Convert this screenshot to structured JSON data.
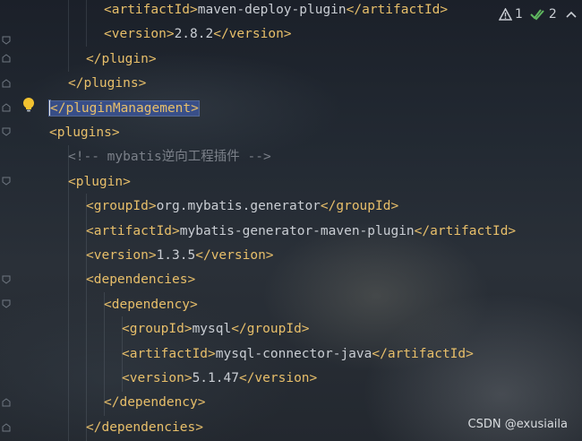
{
  "editor": {
    "lines": [
      {
        "parts": [
          {
            "t": "tag",
            "v": "<artifactId>"
          },
          {
            "t": "txt",
            "v": "maven-deploy-plugin"
          },
          {
            "t": "tag",
            "v": "</artifactId>"
          }
        ]
      },
      {
        "parts": [
          {
            "t": "tag",
            "v": "<version>"
          },
          {
            "t": "txt",
            "v": "2.8.2"
          },
          {
            "t": "tag",
            "v": "</version>"
          }
        ]
      },
      {
        "parts": [
          {
            "t": "tag",
            "v": "</plugin>"
          }
        ]
      },
      {
        "parts": [
          {
            "t": "tag",
            "v": "</plugins>"
          }
        ]
      },
      {
        "parts": [
          {
            "t": "tag",
            "v": "</pluginManagement>"
          }
        ],
        "selected": true
      },
      {
        "parts": [
          {
            "t": "tag",
            "v": "<plugins>"
          }
        ]
      },
      {
        "parts": [
          {
            "t": "cmt",
            "v": "<!-- mybatis逆向工程插件 -->"
          }
        ]
      },
      {
        "parts": [
          {
            "t": "tag",
            "v": "<plugin>"
          }
        ]
      },
      {
        "parts": [
          {
            "t": "tag",
            "v": "<groupId>"
          },
          {
            "t": "txt",
            "v": "org.mybatis.generator"
          },
          {
            "t": "tag",
            "v": "</groupId>"
          }
        ]
      },
      {
        "parts": [
          {
            "t": "tag",
            "v": "<artifactId>"
          },
          {
            "t": "txt",
            "v": "mybatis-generator-maven-plugin"
          },
          {
            "t": "tag",
            "v": "</artifactId>"
          }
        ]
      },
      {
        "parts": [
          {
            "t": "tag",
            "v": "<version>"
          },
          {
            "t": "txt",
            "v": "1.3.5"
          },
          {
            "t": "tag",
            "v": "</version>"
          }
        ]
      },
      {
        "parts": [
          {
            "t": "tag",
            "v": "<dependencies>"
          }
        ]
      },
      {
        "parts": [
          {
            "t": "tag",
            "v": "<dependency>"
          }
        ]
      },
      {
        "parts": [
          {
            "t": "tag",
            "v": "<groupId>"
          },
          {
            "t": "txt",
            "v": "mysql"
          },
          {
            "t": "tag",
            "v": "</groupId>"
          }
        ]
      },
      {
        "parts": [
          {
            "t": "tag",
            "v": "<artifactId>"
          },
          {
            "t": "txt",
            "v": "mysql-connector-java"
          },
          {
            "t": "tag",
            "v": "</artifactId>"
          }
        ]
      },
      {
        "parts": [
          {
            "t": "tag",
            "v": "<version>"
          },
          {
            "t": "txt",
            "v": "5.1.47"
          },
          {
            "t": "tag",
            "v": "</version>"
          }
        ]
      },
      {
        "parts": [
          {
            "t": "tag",
            "v": "</dependency>"
          }
        ]
      },
      {
        "parts": [
          {
            "t": "tag",
            "v": "</dependencies>"
          }
        ]
      }
    ]
  },
  "inspections": {
    "warnings": "1",
    "weak_warnings": "2"
  },
  "watermark": "CSDN @exusiaila",
  "colors": {
    "tag": "#e8bf6a",
    "text": "#c9cdd3",
    "comment": "#7b8089",
    "selection": "#3c5596",
    "warning": "#c9cdd3",
    "check": "#5fb85f"
  },
  "icons": {
    "gutter": "fold-marker-icon",
    "intention": "lightbulb-icon",
    "warning": "warning-triangle-icon",
    "check": "double-check-icon",
    "chevron": "chevron-up-icon"
  }
}
